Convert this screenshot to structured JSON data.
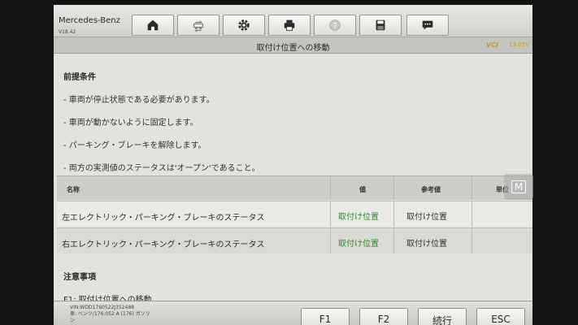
{
  "header": {
    "brand": "Mercedes-Benz",
    "version": "V18.42",
    "toolbar": [
      {
        "icon": "home-icon"
      },
      {
        "icon": "vehicle-swap-icon"
      },
      {
        "icon": "gear-icon"
      },
      {
        "icon": "printer-icon"
      },
      {
        "icon": "help-icon"
      },
      {
        "icon": "save-icon"
      },
      {
        "icon": "chat-icon"
      }
    ]
  },
  "subheader": {
    "title": "取付け位置への移動",
    "vci": "VCI",
    "battery": "13.05V"
  },
  "preconditions": {
    "title": "前提条件",
    "items": [
      "- 車両が停止状態である必要があります。",
      "- 車両が動かないように固定します。",
      "- パーキング・ブレーキを解除します。",
      "- 両方の実測値のステータスは'オープン'であること。"
    ]
  },
  "table": {
    "headers": {
      "name": "名称",
      "value": "値",
      "reference": "参考値",
      "unit": "単位"
    },
    "rows": [
      {
        "name": "左エレクトリック・パーキング・ブレーキのステータス",
        "value": "取付け位置",
        "reference": "取付け位置"
      },
      {
        "name": "右エレクトリック・パーキング・ブレーキのステータス",
        "value": "取付け位置",
        "reference": "取付け位置"
      }
    ]
  },
  "notes": {
    "title": "注意事項",
    "item": "F1: 取付け位置への移動"
  },
  "footer": {
    "vin": "VIN:WDD1760522J352488",
    "model": "車: ベンツ/176.052 A (176) ガソリ",
    "model2": "ン",
    "buttons": {
      "f1": "F1",
      "f2": "F2",
      "continue": "続行",
      "esc": "ESC"
    }
  },
  "side_button": "M",
  "colors": {
    "value_green": "#2f8a2f",
    "vci_gold": "#c89a1a"
  }
}
